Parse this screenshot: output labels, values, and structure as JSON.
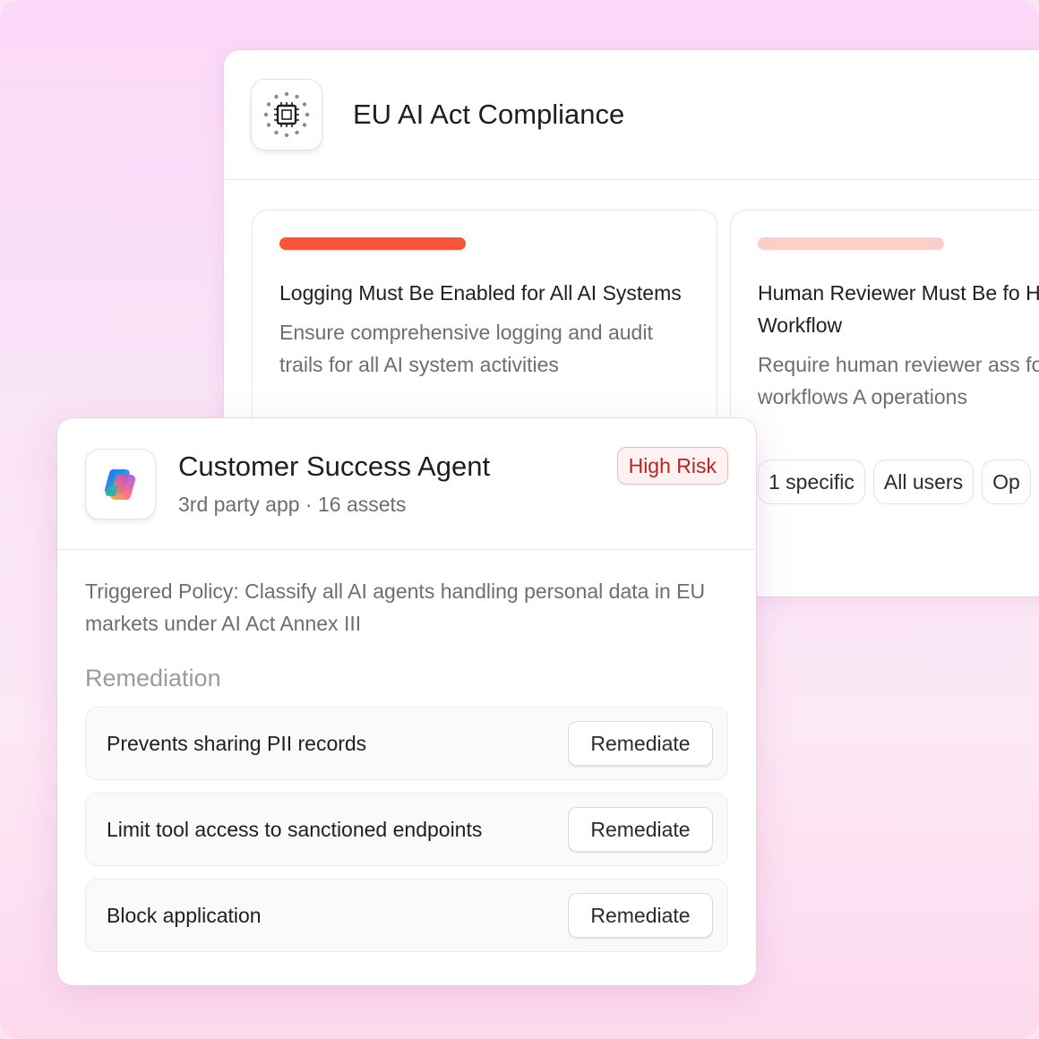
{
  "policy_window": {
    "title": "EU AI Act Compliance",
    "logo_icon": "eu-chip-icon",
    "rules": [
      {
        "severity_color": "#fb5436",
        "title": "Logging Must Be Enabled for All AI Systems",
        "description": "Ensure comprehensive logging and audit trails for all AI system activities"
      },
      {
        "severity_color": "#fdcdc8",
        "title": "Human Reviewer Must Be fo High-Risk AI Workflow",
        "description": "Require human reviewer ass for high-risk AI workflows A operations",
        "chips": [
          "1 specific",
          "All users",
          "Op"
        ]
      }
    ]
  },
  "agent_card": {
    "name": "Customer Success Agent",
    "meta": "3rd party app · 16 assets",
    "risk_badge": "High Risk",
    "app_icon": "copilot-icon",
    "triggered_policy": "Triggered Policy: Classify all AI agents handling personal data in EU markets under AI Act Annex III",
    "remediation_heading": "Remediation",
    "remediations": [
      {
        "label": "Prevents sharing PII records",
        "button": "Remediate"
      },
      {
        "label": "Limit tool access to sanctioned endpoints",
        "button": "Remediate"
      },
      {
        "label": "Block application",
        "button": "Remediate"
      }
    ]
  },
  "colors": {
    "background_top": "#fcd8f8",
    "high_risk_text": "#b5261e",
    "severity_high": "#fb5436",
    "severity_low": "#fdcdc8"
  }
}
